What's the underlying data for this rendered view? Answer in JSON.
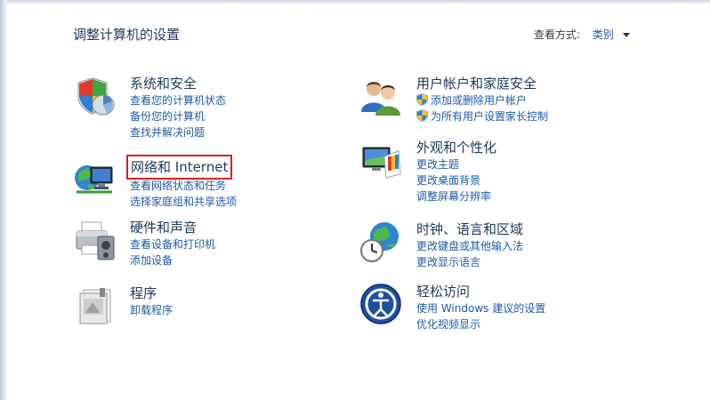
{
  "header": {
    "title": "调整计算机的设置",
    "view_by_label": "查看方式:",
    "view_by_value": "类别"
  },
  "categories": [
    {
      "title": "系统和安全",
      "icon": "shield-security-icon",
      "links": [
        "查看您的计算机状态",
        "备份您的计算机",
        "查找并解决问题"
      ]
    },
    {
      "title": "网络和 Internet",
      "icon": "network-globe-icon",
      "highlighted": true,
      "links": [
        "查看网络状态和任务",
        "选择家庭组和共享选项"
      ]
    },
    {
      "title": "硬件和声音",
      "icon": "printer-icon",
      "links": [
        "查看设备和打印机",
        "添加设备"
      ]
    },
    {
      "title": "程序",
      "icon": "programs-icon",
      "links": [
        "卸载程序"
      ]
    },
    {
      "title": "用户帐户和家庭安全",
      "icon": "users-icon",
      "links": [
        "添加或删除用户帐户",
        "为所有用户设置家长控制"
      ]
    },
    {
      "title": "外观和个性化",
      "icon": "appearance-icon",
      "links": [
        "更改主题",
        "更改桌面背景",
        "调整屏幕分辨率"
      ]
    },
    {
      "title": "时钟、语言和区域",
      "icon": "clock-globe-icon",
      "links": [
        "更改键盘或其他输入法",
        "更改显示语言"
      ]
    },
    {
      "title": "轻松访问",
      "icon": "ease-of-access-icon",
      "links": [
        "使用 Windows 建议的设置",
        "优化视频显示"
      ]
    }
  ],
  "colors": {
    "title": "#1e395b",
    "link": "#1e5aa8",
    "highlight_box": "#d42424"
  }
}
